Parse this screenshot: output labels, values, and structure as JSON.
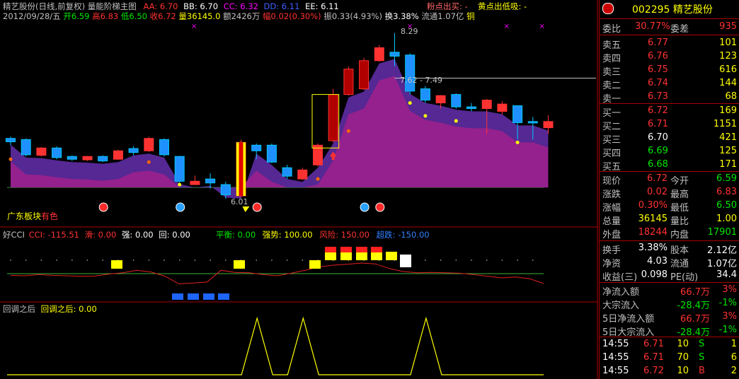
{
  "header": {
    "title": "精艺股份(日线,前复权) 量能阶梯主图",
    "aa": "AA: 6.70",
    "bb": "BB: 6.70",
    "cc": "CC: 6.32",
    "dd": "DD: 6.11",
    "ee": "EE: 6.11",
    "date": "2012/09/28/五",
    "open": "开6.59",
    "high": "高6.83",
    "low": "低6.50",
    "close": "收6.72",
    "vol": "量36145.0",
    "amount": "额2426万",
    "chg": "幅0.02(0.30%)",
    "amp": "振0.33(4.93%)",
    "turnover": "换3.38%",
    "float": "流通1.07亿",
    "sector": "铜",
    "pink_signal": "粉点出买: -",
    "yellow_signal": "黄点出低吸: -"
  },
  "chart_labels": {
    "high_mark": "8.29",
    "mid_mark": "7.62 - 7.49",
    "low_mark": "6.01",
    "sector_label": "广东板块",
    "sector_suffix": "有色"
  },
  "cci_panel": {
    "name": "好CCI",
    "cci": "CCI: -115.51",
    "slip": "滑: 0.00",
    "strong": "强: 0.00",
    "back": "回: 0.00",
    "balance": "平衡: 0.00",
    "power": "强势: 100.00",
    "risk": "风险: 150.00",
    "oversold": "超跌: -150.00"
  },
  "pullback_panel": {
    "name": "回调之后",
    "value": "回调之后: 0.00"
  },
  "sidebar": {
    "code_name": "002295 精艺股份",
    "ratio_label": "委比",
    "ratio_value": "30.77%",
    "diff_label": "委差",
    "diff_value": "935",
    "asks": [
      {
        "label": "卖五",
        "price": "6.77",
        "vol": "101"
      },
      {
        "label": "卖四",
        "price": "6.76",
        "vol": "123"
      },
      {
        "label": "卖三",
        "price": "6.75",
        "vol": "616"
      },
      {
        "label": "卖二",
        "price": "6.74",
        "vol": "144"
      },
      {
        "label": "卖一",
        "price": "6.73",
        "vol": "68"
      }
    ],
    "bids": [
      {
        "label": "买一",
        "price": "6.72",
        "vol": "169"
      },
      {
        "label": "买二",
        "price": "6.71",
        "vol": "1151"
      },
      {
        "label": "买三",
        "price": "6.70",
        "vol": "421"
      },
      {
        "label": "买四",
        "price": "6.69",
        "vol": "125"
      },
      {
        "label": "买五",
        "price": "6.68",
        "vol": "171"
      }
    ],
    "quote": [
      {
        "l1": "现价",
        "v1": "6.72",
        "l2": "今开",
        "v2": "6.59"
      },
      {
        "l1": "涨跌",
        "v1": "0.02",
        "l2": "最高",
        "v2": "6.83"
      },
      {
        "l1": "涨幅",
        "v1": "0.30%",
        "l2": "最低",
        "v2": "6.50"
      },
      {
        "l1": "总量",
        "v1": "36145",
        "l2": "量比",
        "v2": "1.00"
      },
      {
        "l1": "外盘",
        "v1": "18244",
        "l2": "内盘",
        "v2": "17901"
      }
    ],
    "fund": [
      {
        "l1": "换手",
        "v1": "3.38%",
        "l2": "股本",
        "v2": "2.12亿"
      },
      {
        "l1": "净资",
        "v1": "4.03",
        "l2": "流通",
        "v2": "1.07亿"
      },
      {
        "l1": "收益(三)",
        "v1": "0.098",
        "l2": "PE(动)",
        "v2": "34.4"
      }
    ],
    "flows": [
      {
        "label": "净流入额",
        "value": "66.7万",
        "pct": "3%"
      },
      {
        "label": "大宗流入",
        "value": "-28.4万",
        "pct": "-1%"
      },
      {
        "label": "5日净流入额",
        "value": "66.7万",
        "pct": "3%"
      },
      {
        "label": "5日大宗流入",
        "value": "-28.4万",
        "pct": "-1%"
      }
    ],
    "ticks": [
      {
        "time": "14:55",
        "price": "6.71",
        "vol": "10",
        "side": "S",
        "n": "1"
      },
      {
        "time": "14:55",
        "price": "6.71",
        "vol": "70",
        "side": "S",
        "n": "6"
      },
      {
        "time": "14:55",
        "price": "6.72",
        "vol": "10",
        "side": "B",
        "n": "2"
      }
    ]
  },
  "chart_data": {
    "type": "candlestick",
    "title": "精艺股份(日线,前复权) 量能阶梯主图",
    "candles": [
      {
        "open": 6.42,
        "close": 6.36,
        "high": 6.45,
        "low": 6.3
      },
      {
        "open": 6.4,
        "close": 6.13,
        "high": 6.42,
        "low": 6.1
      },
      {
        "open": 6.12,
        "close": 6.25,
        "high": 6.27,
        "low": 6.1
      },
      {
        "open": 6.25,
        "close": 6.08,
        "high": 6.28,
        "low": 6.05
      },
      {
        "open": 6.1,
        "close": 6.05,
        "high": 6.12,
        "low": 6.02
      },
      {
        "open": 6.04,
        "close": 6.1,
        "high": 6.11,
        "low": 6.02
      },
      {
        "open": 6.1,
        "close": 6.02,
        "high": 6.12,
        "low": 6.0
      },
      {
        "open": 6.05,
        "close": 6.2,
        "high": 6.22,
        "low": 6.04
      },
      {
        "open": 6.24,
        "close": 6.17,
        "high": 6.28,
        "low": 6.12
      },
      {
        "open": 6.2,
        "close": 6.42,
        "high": 6.45,
        "low": 6.18
      },
      {
        "open": 6.4,
        "close": 6.13,
        "high": 6.42,
        "low": 6.1
      },
      {
        "open": 6.1,
        "close": 5.66,
        "high": 6.11,
        "low": 5.63
      },
      {
        "open": 5.6,
        "close": 5.66,
        "high": 5.76,
        "low": 5.6
      },
      {
        "open": 5.7,
        "close": 5.63,
        "high": 5.8,
        "low": 5.53
      },
      {
        "open": 5.6,
        "close": 5.42,
        "high": 5.65,
        "low": 5.35
      },
      {
        "open": 5.4,
        "close": 6.35,
        "high": 6.4,
        "low": 5.38
      },
      {
        "open": 6.3,
        "close": 6.2,
        "high": 6.33,
        "low": 6.05
      },
      {
        "open": 6.3,
        "close": 6.0,
        "high": 6.33,
        "low": 5.98
      },
      {
        "open": 5.9,
        "close": 5.75,
        "high": 5.95,
        "low": 5.7
      },
      {
        "open": 5.7,
        "close": 5.86,
        "high": 5.9,
        "low": 5.68
      },
      {
        "open": 5.95,
        "close": 6.3,
        "high": 6.33,
        "low": 5.92
      },
      {
        "open": 6.38,
        "close": 7.2,
        "high": 7.3,
        "low": 6.35
      },
      {
        "open": 7.2,
        "close": 7.65,
        "high": 7.7,
        "low": 7.18
      },
      {
        "open": 7.3,
        "close": 7.8,
        "high": 7.85,
        "low": 7.28
      },
      {
        "open": 7.8,
        "close": 8.03,
        "high": 8.08,
        "low": 7.78
      },
      {
        "open": 7.95,
        "close": 7.88,
        "high": 8.29,
        "low": 7.7
      },
      {
        "open": 7.9,
        "close": 7.26,
        "high": 7.93,
        "low": 7.2
      },
      {
        "open": 7.3,
        "close": 7.1,
        "high": 7.35,
        "low": 7.05
      },
      {
        "open": 7.05,
        "close": 7.18,
        "high": 7.19,
        "low": 6.95
      },
      {
        "open": 7.2,
        "close": 6.98,
        "high": 7.22,
        "low": 6.95
      },
      {
        "open": 6.98,
        "close": 6.95,
        "high": 7.05,
        "low": 6.9
      },
      {
        "open": 6.95,
        "close": 7.1,
        "high": 7.12,
        "low": 6.5
      },
      {
        "open": 6.9,
        "close": 7.03,
        "high": 7.08,
        "low": 6.85
      },
      {
        "open": 7.0,
        "close": 6.7,
        "high": 7.0,
        "low": 6.4
      },
      {
        "open": 6.72,
        "close": 6.7,
        "high": 6.8,
        "low": 6.4
      },
      {
        "open": 6.61,
        "close": 6.72,
        "high": 6.83,
        "low": 6.5
      }
    ],
    "cci": [
      -20,
      -25,
      -10,
      -20,
      -25,
      -30,
      -28,
      -5,
      10,
      40,
      20,
      -30,
      -120,
      -110,
      -100,
      40,
      15,
      10,
      -10,
      -25,
      5,
      40,
      80,
      100,
      110,
      125,
      115,
      60,
      25,
      10,
      15,
      10,
      5,
      -10,
      -30,
      -50,
      -40,
      -60,
      -115.51
    ],
    "pullback_peaks": [
      16,
      19,
      27
    ],
    "mid_mark_range": [
      7.49,
      7.62
    ],
    "high_mark": 8.29,
    "low_mark": 6.01
  }
}
